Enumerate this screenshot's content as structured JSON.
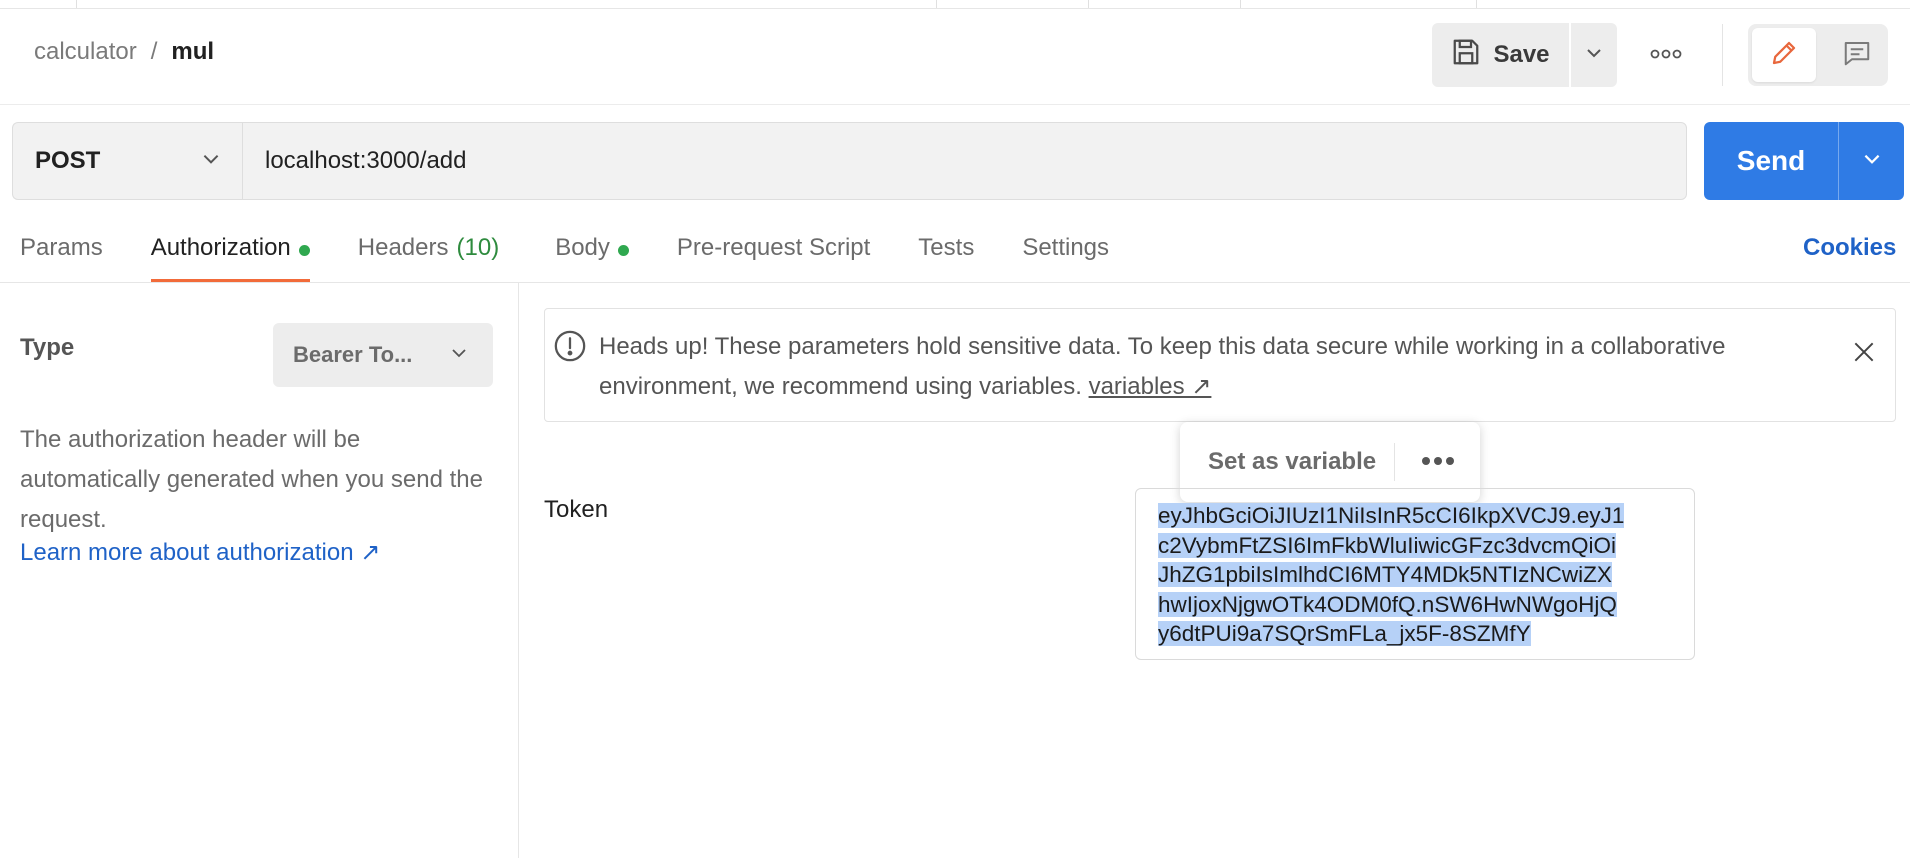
{
  "header": {
    "breadcrumb_parent": "calculator",
    "breadcrumb_separator": "/",
    "breadcrumb_current": "mul",
    "save_label": "Save"
  },
  "request": {
    "method": "POST",
    "url": "localhost:3000/add",
    "send_label": "Send"
  },
  "tabs": [
    {
      "label": "Params",
      "dot": false,
      "count": ""
    },
    {
      "label": "Authorization",
      "dot": true,
      "count": ""
    },
    {
      "label": "Headers",
      "dot": false,
      "count": "(10)"
    },
    {
      "label": "Body",
      "dot": true,
      "count": ""
    },
    {
      "label": "Pre-request Script",
      "dot": false,
      "count": ""
    },
    {
      "label": "Tests",
      "dot": false,
      "count": ""
    },
    {
      "label": "Settings",
      "dot": false,
      "count": ""
    }
  ],
  "active_tab": "Authorization",
  "cookies_label": "Cookies",
  "auth": {
    "type_label": "Type",
    "type_value": "Bearer To...",
    "description": "The authorization header will be automatically generated when you send the request.",
    "learn_more": "Learn more about authorization ↗"
  },
  "alert": {
    "text": "Heads up! These parameters hold sensitive data. To keep this data secure while working in a collaborative environment, we recommend using variables.",
    "link": "variables ↗"
  },
  "popover": {
    "set_variable": "Set as variable"
  },
  "token": {
    "label": "Token",
    "lines": [
      "eyJhbGciOiJIUzI1NiIsInR5cCI6IkpXVCJ9.eyJ1",
      "c2VybmFtZSI6ImFkbWluIiwicGFzc3dvcmQiOi",
      "JhZG1pbiIsImlhdCI6MTY4MDk5NTIzNCwiZX",
      "hwIjoxNjgwOTk4ODM0fQ.nSW6HwNWgoHjQ",
      "y6dtPUi9a7SQrSmFLa_jx5F-8SZMfY"
    ]
  },
  "colors": {
    "accent_send": "#2f7be5",
    "active_tab_underline": "#f26b3a",
    "status_dot": "#2fa84f",
    "link": "#1f62c7",
    "selection": "#b6d1f7"
  }
}
